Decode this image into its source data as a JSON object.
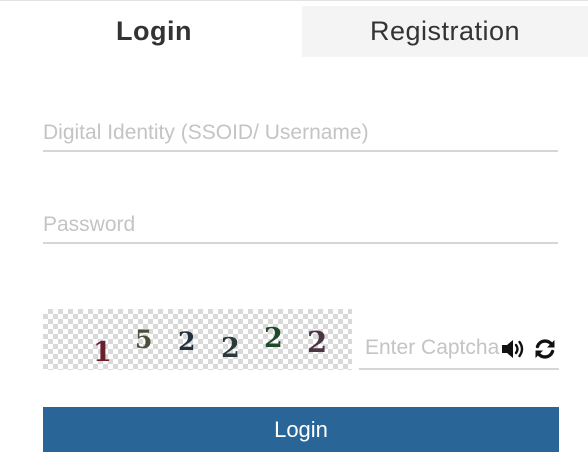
{
  "tabs": {
    "login_label": "Login",
    "registration_label": "Registration"
  },
  "form": {
    "username_placeholder": "Digital Identity (SSOID/ Username)",
    "username_value": "",
    "password_placeholder": "Password",
    "password_value": "",
    "captcha_digits": [
      "1",
      "5",
      "2",
      "2",
      "2",
      "2"
    ],
    "captcha_placeholder": "Enter Captcha",
    "captcha_value": "",
    "audio_icon": "speaker-volume-icon",
    "refresh_icon": "refresh-icon",
    "submit_label": "Login"
  },
  "colors": {
    "primary_button": "#2a6598",
    "inactive_tab_bg": "#f4f4f4",
    "placeholder": "#c4c4c4",
    "underline": "#d6d6d6"
  }
}
